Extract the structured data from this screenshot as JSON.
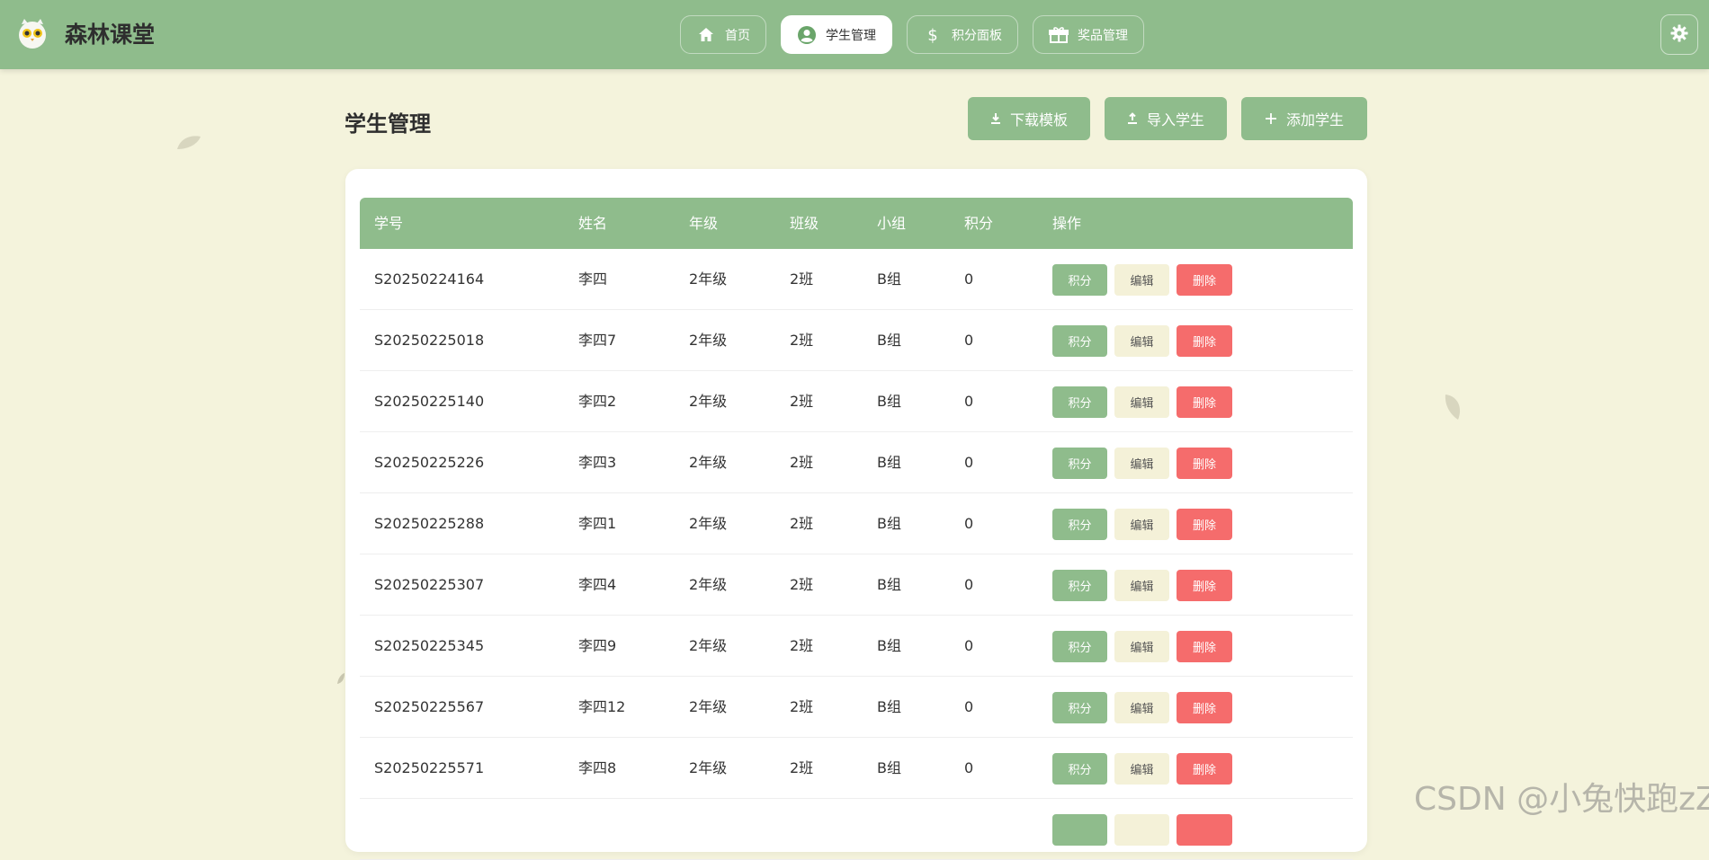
{
  "brand": {
    "name": "森林课堂"
  },
  "nav": [
    {
      "label": "首页",
      "icon": "home-icon",
      "active": false
    },
    {
      "label": "学生管理",
      "icon": "user-icon",
      "active": true
    },
    {
      "label": "积分面板",
      "icon": "dollar-icon",
      "active": false
    },
    {
      "label": "奖品管理",
      "icon": "gift-icon",
      "active": false
    }
  ],
  "page": {
    "title": "学生管理",
    "actions": {
      "download": "下载模板",
      "import": "导入学生",
      "add": "添加学生"
    }
  },
  "table": {
    "columns": [
      "学号",
      "姓名",
      "年级",
      "班级",
      "小组",
      "积分",
      "操作"
    ],
    "op_labels": {
      "score": "积分",
      "edit": "编辑",
      "delete": "删除"
    },
    "rows": [
      [
        "S20250224164",
        "李四",
        "2年级",
        "2班",
        "B组",
        "0"
      ],
      [
        "S20250225018",
        "李四7",
        "2年级",
        "2班",
        "B组",
        "0"
      ],
      [
        "S20250225140",
        "李四2",
        "2年级",
        "2班",
        "B组",
        "0"
      ],
      [
        "S20250225226",
        "李四3",
        "2年级",
        "2班",
        "B组",
        "0"
      ],
      [
        "S20250225288",
        "李四1",
        "2年级",
        "2班",
        "B组",
        "0"
      ],
      [
        "S20250225307",
        "李四4",
        "2年级",
        "2班",
        "B组",
        "0"
      ],
      [
        "S20250225345",
        "李四9",
        "2年级",
        "2班",
        "B组",
        "0"
      ],
      [
        "S20250225567",
        "李四12",
        "2年级",
        "2班",
        "B组",
        "0"
      ],
      [
        "S20250225571",
        "李四8",
        "2年级",
        "2班",
        "B组",
        "0"
      ]
    ]
  },
  "colors": {
    "primary": "#8fbc8c",
    "background": "#f4f3dc",
    "danger": "#f56c6c",
    "edit_bg": "#f4f1d8"
  },
  "watermark": "CSDN @小兔快跑zZ"
}
